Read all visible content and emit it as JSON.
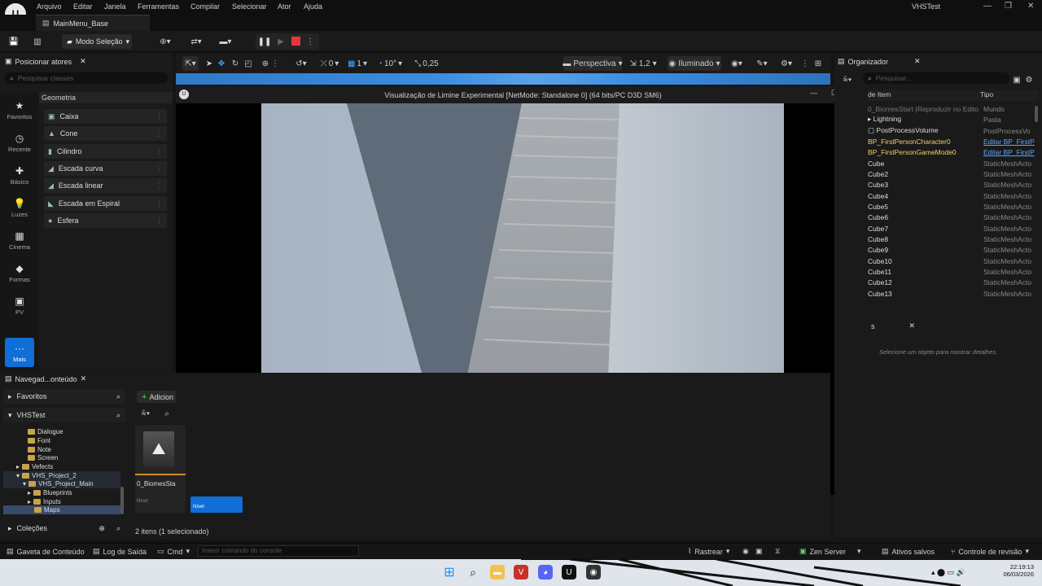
{
  "menubar": {
    "logo": "U",
    "items": [
      "Arquivo",
      "Editar",
      "Janela",
      "Ferramentas",
      "Compilar",
      "Selecionar",
      "Ator",
      "Ajuda"
    ],
    "project_name": "VHSTest",
    "controls": [
      "—",
      "❐",
      "✕"
    ]
  },
  "doc_tab": {
    "label": "MainMenu_Base"
  },
  "toolbar": {
    "mode_label": "Modo Seleção"
  },
  "viewport_toolbar": {
    "snap_rotation": "0",
    "grid_size": "1",
    "angle": "10°",
    "scale": "0,25",
    "perspective_label": "Perspectiva",
    "speed": "1,2",
    "lit_label": "Iluminado"
  },
  "left_panel": {
    "title": "Posicionar atores",
    "search_placeholder": "Pesquisar classes",
    "categories": [
      {
        "icon": "star-icon",
        "glyph": "★",
        "label": "Favoritos"
      },
      {
        "icon": "clock-icon",
        "glyph": "◷",
        "label": "Recente"
      },
      {
        "icon": "basic-icon",
        "glyph": "✚",
        "label": "Básico"
      },
      {
        "icon": "light-icon",
        "glyph": "💡",
        "label": "Luzes"
      },
      {
        "icon": "cinema-icon",
        "glyph": "▦",
        "label": "Cinema"
      },
      {
        "icon": "shapes-icon",
        "glyph": "◆",
        "label": "Formas"
      },
      {
        "icon": "volume-icon",
        "glyph": "▣",
        "label": "PV"
      },
      {
        "icon": "more-icon",
        "glyph": "···",
        "label": "Mais"
      }
    ],
    "geometry_header": "Geometria",
    "shapes": [
      "Caixa",
      "Cone",
      "Cilindro",
      "Escada curva",
      "Escada linear",
      "Escada em Espiral",
      "Esfera"
    ]
  },
  "pie_window": {
    "title": "Visualização de Limine Experimental [NetMode: Standalone 0]  (64 bits/PC D3D SM6)",
    "controls": [
      "—",
      "☐",
      "✕"
    ]
  },
  "outliner": {
    "title": "Organizador",
    "search_placeholder": "Pesquisar...",
    "col_item": "de Item",
    "col_type": "Tipo",
    "rows": [
      {
        "name": "0_BiomesStart (Reproduzir no Edito",
        "type": "Mundo"
      },
      {
        "name": "Lightning",
        "type": "Pasta"
      },
      {
        "name": "PostProcessVolume",
        "type": "PostProcessVo"
      },
      {
        "name": "BP_FirstPersonCharacter0",
        "type": "Editar BP_FirstP"
      },
      {
        "name": "BP_FirstPersonGameMode0",
        "type": "Editar BP_FirstP"
      },
      {
        "name": "Cube",
        "type": "StaticMeshActo"
      },
      {
        "name": "Cube2",
        "type": "StaticMeshActo"
      },
      {
        "name": "Cube3",
        "type": "StaticMeshActo"
      },
      {
        "name": "Cube4",
        "type": "StaticMeshActo"
      },
      {
        "name": "Cube5",
        "type": "StaticMeshActo"
      },
      {
        "name": "Cube6",
        "type": "StaticMeshActo"
      },
      {
        "name": "Cube7",
        "type": "StaticMeshActo"
      },
      {
        "name": "Cube8",
        "type": "StaticMeshActo"
      },
      {
        "name": "Cube9",
        "type": "StaticMeshActo"
      },
      {
        "name": "Cube10",
        "type": "StaticMeshActo"
      },
      {
        "name": "Cube11",
        "type": "StaticMeshActo"
      },
      {
        "name": "Cube12",
        "type": "StaticMeshActo"
      },
      {
        "name": "Cube13",
        "type": "StaticMeshActo"
      }
    ]
  },
  "details": {
    "tab_label": "s",
    "empty_message": "Selecione um objeto para mostrar detalhes."
  },
  "content_browser": {
    "tab_label": "Navegad...onteúdo",
    "favorites_label": "Favoritos",
    "project_label": "VHSTest",
    "add_label": "Adicion",
    "tree": [
      {
        "label": "Dialogue",
        "indent": 3
      },
      {
        "label": "Font",
        "indent": 3
      },
      {
        "label": "Note",
        "indent": 3
      },
      {
        "label": "Screen",
        "indent": 3
      },
      {
        "label": "Vefects",
        "indent": 1
      },
      {
        "label": "VHS_Project_2",
        "indent": 1
      },
      {
        "label": "VHS_Project_Main",
        "indent": 2
      },
      {
        "label": "Blueprints",
        "indent": 3
      },
      {
        "label": "Inputs",
        "indent": 3
      },
      {
        "label": "Maps",
        "indent": 3
      }
    ],
    "asset_name": "0_BiomesSta",
    "asset_type": "Nível",
    "asset_type_2": "Nível",
    "collections_label": "Coleções",
    "item_count": "2 itens (1 selecionado)"
  },
  "statusbar": {
    "content_drawer": "Gaveta de Conteúdo",
    "output_log": "Log de Saída",
    "cmd": "Cmd",
    "console_placeholder": "Inserir comando do console",
    "trace": "Rastrear",
    "zen": "Zen Server",
    "saved": "Ativos salvos",
    "revision": "Controle de revisão"
  },
  "taskbar": {
    "time": "22:19:13",
    "date": "06/03/2026"
  }
}
